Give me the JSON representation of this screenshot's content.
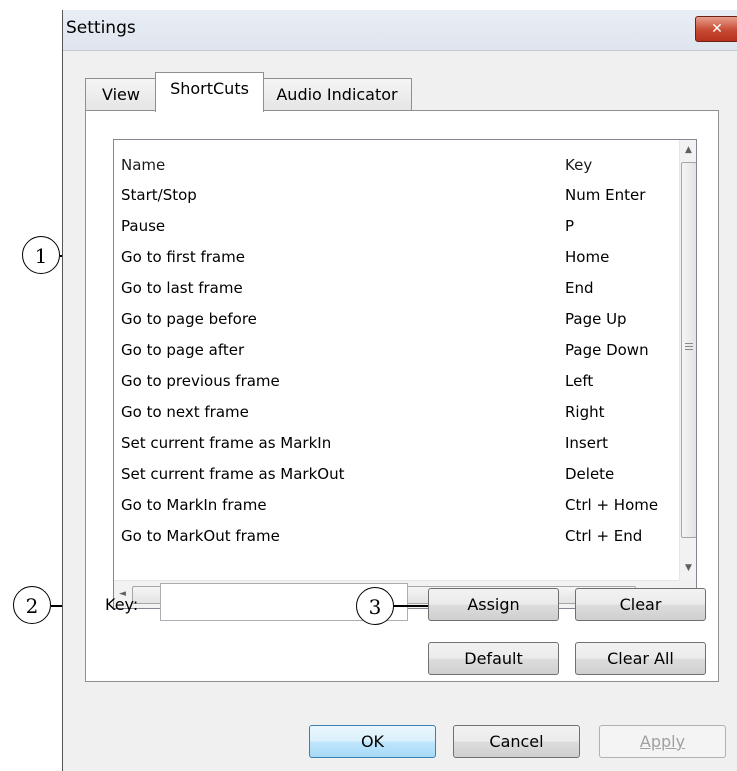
{
  "window": {
    "title": "Settings",
    "close_icon": "close-icon"
  },
  "tabs": [
    {
      "label": "View",
      "active": false
    },
    {
      "label": "ShortCuts",
      "active": true
    },
    {
      "label": "Audio Indicator",
      "active": false
    }
  ],
  "shortcuts": {
    "columns": {
      "name": "Name",
      "key": "Key"
    },
    "rows": [
      {
        "name": "Start/Stop",
        "key": "Num Enter"
      },
      {
        "name": "Pause",
        "key": "P"
      },
      {
        "name": "Go to first frame",
        "key": "Home"
      },
      {
        "name": "Go to last frame",
        "key": "End"
      },
      {
        "name": "Go to page before",
        "key": "Page Up"
      },
      {
        "name": "Go to page after",
        "key": "Page Down"
      },
      {
        "name": "Go to previous frame",
        "key": "Left"
      },
      {
        "name": "Go to next frame",
        "key": "Right"
      },
      {
        "name": "Set current frame as MarkIn",
        "key": "Insert"
      },
      {
        "name": "Set current frame as MarkOut",
        "key": "Delete"
      },
      {
        "name": "Go to MarkIn frame",
        "key": "Ctrl + Home"
      },
      {
        "name": "Go to MarkOut frame",
        "key": "Ctrl + End"
      }
    ],
    "scroll": {
      "up": "▲",
      "down": "▼",
      "left": "◄",
      "right": "►",
      "grip": "III"
    }
  },
  "key_field": {
    "label": "Key:",
    "value": ""
  },
  "buttons": {
    "assign": "Assign",
    "clear": "Clear",
    "default": "Default",
    "clear_all": "Clear All",
    "ok": "OK",
    "cancel": "Cancel",
    "apply": "Apply"
  },
  "callouts": [
    "1",
    "2",
    "3"
  ],
  "colors": {
    "close_button": "#c74a32",
    "focus_border": "#3c7fb1",
    "disabled_text": "#a0a0a0"
  }
}
